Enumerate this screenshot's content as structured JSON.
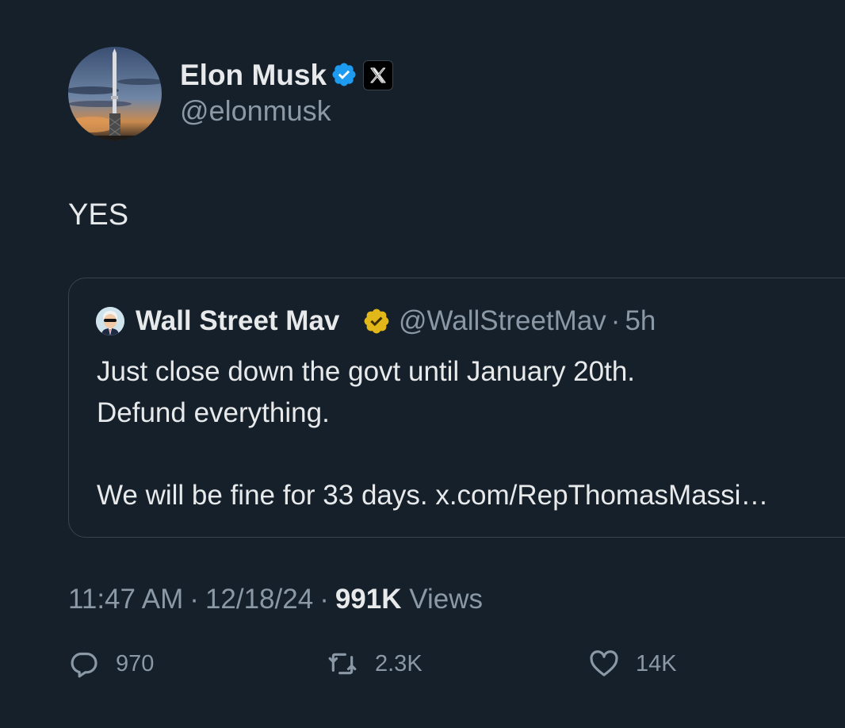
{
  "tweet": {
    "author": {
      "name": "Elon Musk",
      "handle": "@elonmusk",
      "verified_color": "#1d9bf0"
    },
    "text": "YES",
    "quoted": {
      "name": "Wall Street Mav",
      "handle": "@WallStreetMav",
      "separator": "·",
      "age": "5h",
      "verified_color": "#e2b719",
      "body": "Just close down the govt until January 20th.\nDefund everything.\n\nWe will be fine for 33 days. x.com/RepThomasMassi…"
    },
    "meta": {
      "time": "11:47 AM",
      "separator": "·",
      "date": "12/18/24",
      "views_count": "991K",
      "views_label": "Views"
    },
    "actions": {
      "replies": "970",
      "reposts": "2.3K",
      "likes": "14K"
    }
  },
  "colors": {
    "background": "#15202b",
    "text": "#e7e9ea",
    "muted": "#8b98a5",
    "border": "#38444d"
  }
}
